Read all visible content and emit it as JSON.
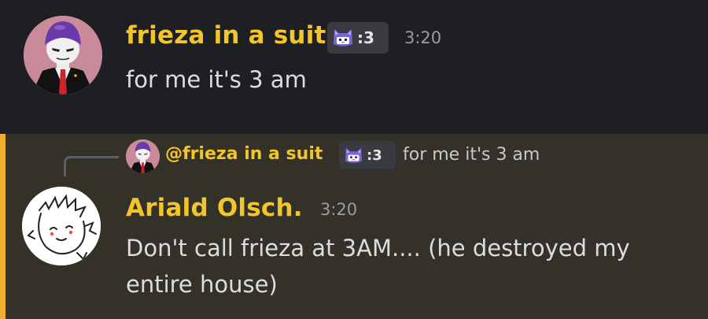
{
  "message_1": {
    "author": "frieza in a suit",
    "author_color": "#f2c52b",
    "tag": ":3",
    "tag_icon": "cat-icon",
    "timestamp": "3:20",
    "text": "for me it's 3 am",
    "avatar": "frieza-avatar"
  },
  "message_2": {
    "highlight_color": "#f0b132",
    "reply": {
      "author": "@frieza in a suit",
      "author_color": "#f2c52b",
      "tag": ":3",
      "tag_icon": "cat-icon",
      "preview_text": "for me it's 3 am",
      "avatar": "frieza-avatar"
    },
    "author": "Ariald Olsch.",
    "author_color": "#f2c52b",
    "timestamp": "3:20",
    "text": "Don't call frieza at 3AM.... (he destroyed my entire house)",
    "avatar": "sketch-avatar"
  }
}
